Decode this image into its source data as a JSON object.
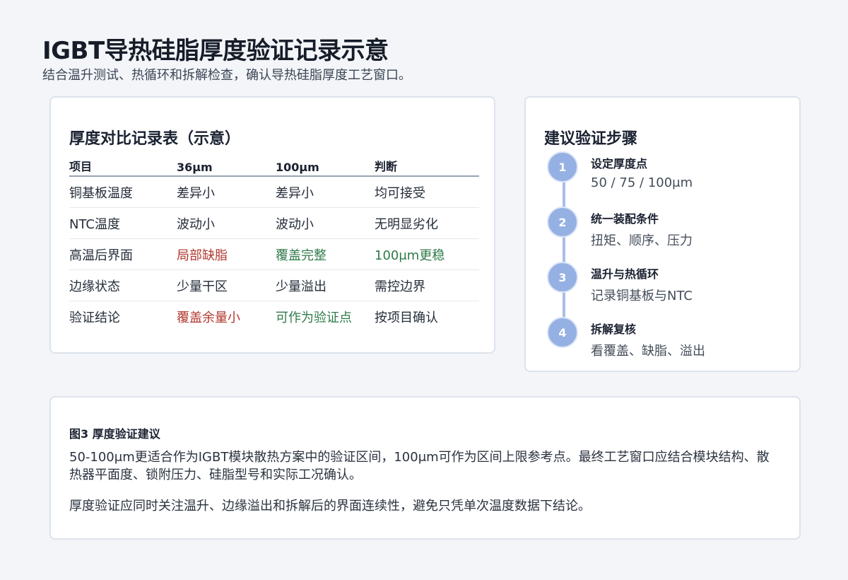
{
  "header": {
    "title": "IGBT导热硅脂厚度验证记录示意",
    "subtitle": "结合温升测试、热循环和拆解检查，确认导热硅脂厚度工艺窗口。"
  },
  "table_card": {
    "heading": "厚度对比记录表（示意）",
    "columns": [
      "项目",
      "36μm",
      "100μm",
      "判断"
    ],
    "rows": [
      {
        "item": "铜基板温度",
        "c36": "差异小",
        "c100": "差异小",
        "judge": "均可接受"
      },
      {
        "item": "NTC温度",
        "c36": "波动小",
        "c100": "波动小",
        "judge": "无明显劣化"
      },
      {
        "item": "高温后界面",
        "c36": "局部缺脂",
        "c100": "覆盖完整",
        "judge": "100μm更稳"
      },
      {
        "item": "边缘状态",
        "c36": "少量干区",
        "c100": "少量溢出",
        "judge": "需控边界"
      },
      {
        "item": "验证结论",
        "c36": "覆盖余量小",
        "c100": "可作为验证点",
        "judge": "按项目确认"
      }
    ],
    "colors": {
      "negative": "#b2382f",
      "positive": "#2f7a4a"
    }
  },
  "steps_card": {
    "heading": "建议验证步骤",
    "steps": [
      {
        "num": "1",
        "title": "设定厚度点",
        "desc": "50 / 75 / 100μm"
      },
      {
        "num": "2",
        "title": "统一装配条件",
        "desc": "扭矩、顺序、压力"
      },
      {
        "num": "3",
        "title": "温升与热循环",
        "desc": "记录铜基板与NTC"
      },
      {
        "num": "4",
        "title": "拆解复核",
        "desc": "看覆盖、缺脂、溢出"
      }
    ],
    "accent": "#95b0e3"
  },
  "note_card": {
    "caption": "图3  厚度验证建议",
    "paragraphs": [
      "50-100μm更适合作为IGBT模块散热方案中的验证区间，100μm可作为区间上限参考点。最终工艺窗口应结合模块结构、散热器平面度、锁附压力、硅脂型号和实际工况确认。",
      "厚度验证应同时关注温升、边缘溢出和拆解后的界面连续性，避免只凭单次温度数据下结论。"
    ]
  }
}
